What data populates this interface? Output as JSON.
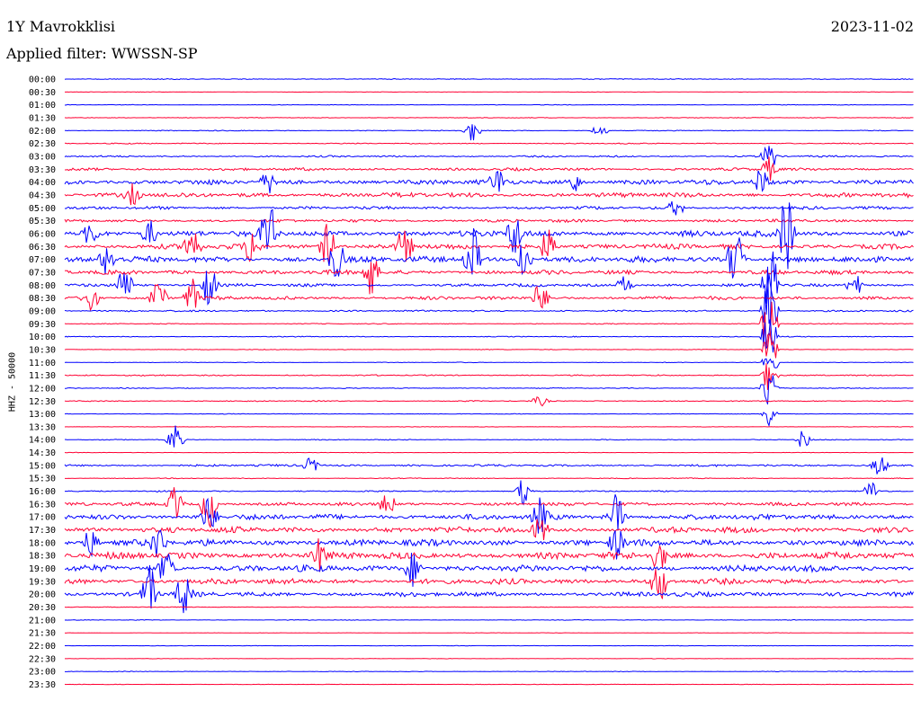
{
  "header": {
    "station": "1Y Mavrokklisi",
    "date": "2023-11-02",
    "filter": "Applied filter: WWSSN-SP"
  },
  "chart_data": {
    "type": "line",
    "title": "1Y Mavrokklisi",
    "date": "2023-11-02",
    "filter": "WWSSN-SP",
    "ylabel": "HHZ - 50000",
    "xlabel": "",
    "colors": {
      "even_line": "#0000ff",
      "odd_line": "#ff0033",
      "background": "#ffffff"
    },
    "row_times": [
      "00:00",
      "00:30",
      "01:00",
      "01:30",
      "02:00",
      "02:30",
      "03:00",
      "03:30",
      "04:00",
      "04:30",
      "05:00",
      "05:30",
      "06:00",
      "06:30",
      "07:00",
      "07:30",
      "08:00",
      "08:30",
      "09:00",
      "09:30",
      "10:00",
      "10:30",
      "11:00",
      "11:30",
      "12:00",
      "12:30",
      "13:00",
      "13:30",
      "14:00",
      "14:30",
      "15:00",
      "15:30",
      "16:00",
      "16:30",
      "17:00",
      "17:30",
      "18:00",
      "18:30",
      "19:00",
      "19:30",
      "20:00",
      "20:30",
      "21:00",
      "21:30",
      "22:00",
      "22:30",
      "23:00",
      "23:30"
    ],
    "row_activity": [
      0.4,
      0.2,
      0.3,
      0.3,
      0.4,
      0.5,
      0.8,
      1.3,
      2.4,
      2.2,
      1.4,
      1.4,
      2.8,
      2.4,
      2.8,
      2.0,
      1.4,
      1.6,
      0.8,
      0.4,
      0.4,
      0.3,
      0.3,
      0.6,
      0.4,
      0.5,
      0.3,
      0.2,
      0.4,
      0.2,
      1.0,
      0.4,
      0.6,
      1.6,
      2.6,
      2.8,
      3.0,
      3.2,
      3.0,
      2.6,
      2.2,
      0.3,
      0.3,
      0.2,
      0.2,
      0.2,
      0.3,
      0.2
    ],
    "events": [
      {
        "row": 4,
        "pos": 0.48,
        "amp": 14
      },
      {
        "row": 4,
        "pos": 0.63,
        "amp": 8
      },
      {
        "row": 6,
        "pos": 0.83,
        "amp": 18
      },
      {
        "row": 7,
        "pos": 0.83,
        "amp": 14
      },
      {
        "row": 8,
        "pos": 0.24,
        "amp": 12
      },
      {
        "row": 8,
        "pos": 0.51,
        "amp": 16
      },
      {
        "row": 8,
        "pos": 0.6,
        "amp": 12
      },
      {
        "row": 8,
        "pos": 0.82,
        "amp": 16
      },
      {
        "row": 9,
        "pos": 0.08,
        "amp": 12
      },
      {
        "row": 10,
        "pos": 0.72,
        "amp": 10
      },
      {
        "row": 12,
        "pos": 0.03,
        "amp": 14
      },
      {
        "row": 12,
        "pos": 0.1,
        "amp": 16
      },
      {
        "row": 12,
        "pos": 0.24,
        "amp": 40
      },
      {
        "row": 12,
        "pos": 0.53,
        "amp": 30
      },
      {
        "row": 12,
        "pos": 0.85,
        "amp": 50
      },
      {
        "row": 13,
        "pos": 0.15,
        "amp": 30
      },
      {
        "row": 13,
        "pos": 0.22,
        "amp": 26
      },
      {
        "row": 13,
        "pos": 0.31,
        "amp": 28
      },
      {
        "row": 13,
        "pos": 0.4,
        "amp": 26
      },
      {
        "row": 13,
        "pos": 0.57,
        "amp": 24
      },
      {
        "row": 14,
        "pos": 0.05,
        "amp": 20
      },
      {
        "row": 14,
        "pos": 0.32,
        "amp": 26
      },
      {
        "row": 14,
        "pos": 0.48,
        "amp": 40
      },
      {
        "row": 14,
        "pos": 0.54,
        "amp": 30
      },
      {
        "row": 14,
        "pos": 0.79,
        "amp": 40
      },
      {
        "row": 15,
        "pos": 0.36,
        "amp": 30
      },
      {
        "row": 16,
        "pos": 0.07,
        "amp": 28
      },
      {
        "row": 16,
        "pos": 0.17,
        "amp": 28
      },
      {
        "row": 16,
        "pos": 0.66,
        "amp": 12
      },
      {
        "row": 16,
        "pos": 0.83,
        "amp": 60
      },
      {
        "row": 16,
        "pos": 0.93,
        "amp": 16
      },
      {
        "row": 17,
        "pos": 0.03,
        "amp": 20
      },
      {
        "row": 17,
        "pos": 0.11,
        "amp": 24
      },
      {
        "row": 17,
        "pos": 0.15,
        "amp": 22
      },
      {
        "row": 17,
        "pos": 0.56,
        "amp": 20
      },
      {
        "row": 18,
        "pos": 0.83,
        "amp": 55
      },
      {
        "row": 19,
        "pos": 0.83,
        "amp": 40
      },
      {
        "row": 20,
        "pos": 0.83,
        "amp": 30
      },
      {
        "row": 21,
        "pos": 0.83,
        "amp": 25
      },
      {
        "row": 22,
        "pos": 0.83,
        "amp": 22
      },
      {
        "row": 23,
        "pos": 0.83,
        "amp": 20
      },
      {
        "row": 24,
        "pos": 0.83,
        "amp": 30
      },
      {
        "row": 25,
        "pos": 0.56,
        "amp": 6
      },
      {
        "row": 26,
        "pos": 0.83,
        "amp": 16
      },
      {
        "row": 28,
        "pos": 0.13,
        "amp": 20
      },
      {
        "row": 28,
        "pos": 0.87,
        "amp": 12
      },
      {
        "row": 30,
        "pos": 0.29,
        "amp": 10
      },
      {
        "row": 30,
        "pos": 0.96,
        "amp": 14
      },
      {
        "row": 32,
        "pos": 0.54,
        "amp": 16
      },
      {
        "row": 32,
        "pos": 0.95,
        "amp": 12
      },
      {
        "row": 33,
        "pos": 0.13,
        "amp": 24
      },
      {
        "row": 33,
        "pos": 0.17,
        "amp": 30
      },
      {
        "row": 33,
        "pos": 0.38,
        "amp": 16
      },
      {
        "row": 34,
        "pos": 0.17,
        "amp": 24
      },
      {
        "row": 34,
        "pos": 0.56,
        "amp": 20
      },
      {
        "row": 34,
        "pos": 0.65,
        "amp": 28
      },
      {
        "row": 35,
        "pos": 0.56,
        "amp": 16
      },
      {
        "row": 36,
        "pos": 0.03,
        "amp": 16
      },
      {
        "row": 36,
        "pos": 0.11,
        "amp": 20
      },
      {
        "row": 36,
        "pos": 0.65,
        "amp": 18
      },
      {
        "row": 37,
        "pos": 0.3,
        "amp": 18
      },
      {
        "row": 37,
        "pos": 0.7,
        "amp": 20
      },
      {
        "row": 38,
        "pos": 0.12,
        "amp": 22
      },
      {
        "row": 38,
        "pos": 0.41,
        "amp": 20
      },
      {
        "row": 39,
        "pos": 0.7,
        "amp": 28
      },
      {
        "row": 40,
        "pos": 0.1,
        "amp": 34
      },
      {
        "row": 40,
        "pos": 0.14,
        "amp": 26
      }
    ],
    "grid": false
  }
}
